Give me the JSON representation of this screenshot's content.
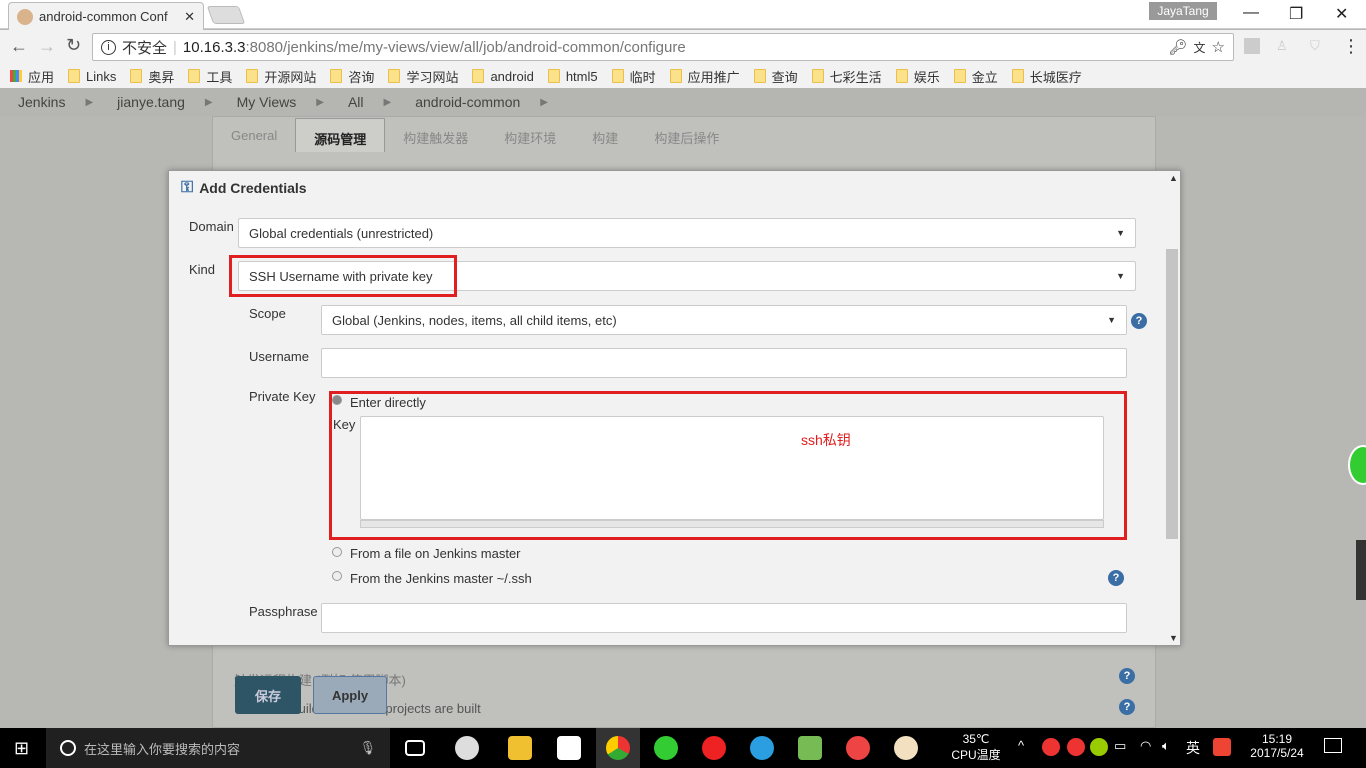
{
  "browser": {
    "tab_title": "android-common Conf",
    "profile": "JayaTang",
    "url_security": "不安全",
    "url_host": "10.16.3.3",
    "url_path": ":8080/jenkins/me/my-views/view/all/job/android-common/configure"
  },
  "bookmarks": [
    "应用",
    "Links",
    "奥昇",
    "工具",
    "开源网站",
    "咨询",
    "学习网站",
    "android",
    "html5",
    "临时",
    "应用推广",
    "查询",
    "七彩生活",
    "娱乐",
    "金立",
    "长城医疗"
  ],
  "breadcrumb": [
    "Jenkins",
    "jianye.tang",
    "My Views",
    "All",
    "android-common"
  ],
  "config_tabs": [
    "General",
    "源码管理",
    "构建触发器",
    "构建环境",
    "构建",
    "构建后操作"
  ],
  "dialog": {
    "title": "Add Credentials",
    "domain_label": "Domain",
    "domain_value": "Global credentials (unrestricted)",
    "kind_label": "Kind",
    "kind_value": "SSH Username with private key",
    "scope_label": "Scope",
    "scope_value": "Global (Jenkins, nodes, items, all child items, etc)",
    "username_label": "Username",
    "username_value": "",
    "private_key_label": "Private Key",
    "enter_directly": "Enter directly",
    "key_label": "Key",
    "key_annotation": "ssh私钥",
    "from_file": "From a file on Jenkins master",
    "from_ssh": "From the Jenkins master ~/.ssh",
    "passphrase_label": "Passphrase",
    "passphrase_value": ""
  },
  "background": {
    "option1": "触发远程构建 (例如,使用脚本)",
    "option2": "Build after other projects are built",
    "save": "保存",
    "apply": "Apply"
  },
  "taskbar": {
    "search_placeholder": "在这里输入你要搜索的内容",
    "temp": "35℃",
    "temp_label": "CPU温度",
    "ime": "英",
    "time": "15:19",
    "date": "2017/5/24"
  },
  "colors": {
    "highlight": "#e02020",
    "save_button": "#2e5566",
    "apply_button": "#9aaab8"
  }
}
